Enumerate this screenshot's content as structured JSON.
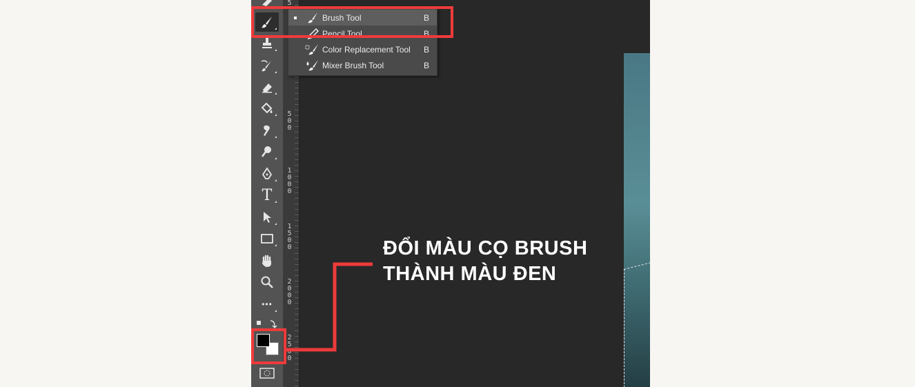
{
  "tool_menu": {
    "items": [
      {
        "label": "Brush Tool",
        "shortcut": "B",
        "icon": "brush-icon",
        "selected": true
      },
      {
        "label": "Pencil Tool",
        "shortcut": "B",
        "icon": "pencil-icon",
        "selected": false
      },
      {
        "label": "Color Replacement Tool",
        "shortcut": "B",
        "icon": "color-replacement-icon",
        "selected": false
      },
      {
        "label": "Mixer Brush Tool",
        "shortcut": "B",
        "icon": "mixer-brush-icon",
        "selected": false
      }
    ]
  },
  "toolbar": {
    "tools": [
      "eraser-partial-icon",
      "brush-icon",
      "stamp-icon",
      "history-brush-icon",
      "eraser-icon",
      "paint-bucket-icon",
      "smudge-icon",
      "dodge-icon",
      "pen-icon",
      "type-icon",
      "path-selection-icon",
      "rectangle-icon",
      "hand-icon",
      "zoom-icon",
      "more-icon"
    ],
    "type_tool_glyph": "T",
    "more_glyph": "•••"
  },
  "ruler": {
    "labels": [
      "5",
      "500",
      "1000",
      "1500",
      "2000",
      "2500"
    ]
  },
  "colors": {
    "foreground": "#000000",
    "background": "#ffffff",
    "highlight": "#ee3b3b"
  },
  "annotation": {
    "line1": "ĐỔI MÀU CỌ BRUSH",
    "line2": "THÀNH MÀU ĐEN"
  }
}
